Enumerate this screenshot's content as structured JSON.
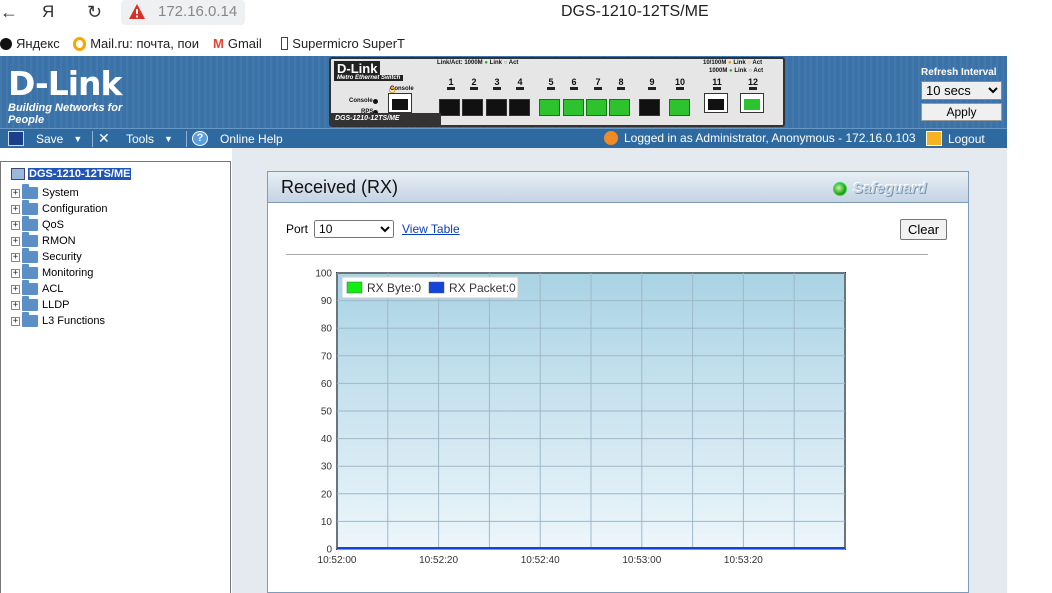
{
  "browser": {
    "back_icon": "arrow-left-icon",
    "yandex_icon": "yandex-icon",
    "reload_icon": "reload-icon",
    "security_warning_icon": "warning-triangle-icon",
    "url": "172.16.0.14",
    "page_title": "DGS-1210-12TS/ME",
    "bookmarks": [
      {
        "label": "Яндекс",
        "icon": "yandex-plus-icon",
        "color": "#111111"
      },
      {
        "label": "Mail.ru: почта, пои",
        "icon": "mailru-icon",
        "color": "#168de2"
      },
      {
        "label": "Gmail",
        "icon": "gmail-icon",
        "color": "#ea4335"
      },
      {
        "label": "Supermicro SuperT",
        "icon": "page-icon",
        "color": "#555555"
      }
    ]
  },
  "header": {
    "brand": "D-Link",
    "tagline": "Building Networks for People",
    "switch_panel": {
      "brand": "D-Link",
      "subtitle": "Metro Ethernet Switch",
      "model": "DGS-1210-12TS/ME",
      "console_label": "Console",
      "console_led_label": "Console",
      "rps_led_label": "RPS",
      "linkact_label": "Link/Act: 1000M",
      "link_label": "Link",
      "act_label": "Act",
      "legend_100": "10/100M",
      "legend_1000": "1000M",
      "ports": [
        {
          "num": "1",
          "active": false
        },
        {
          "num": "2",
          "active": false
        },
        {
          "num": "3",
          "active": false
        },
        {
          "num": "4",
          "active": false
        },
        {
          "num": "5",
          "active": true
        },
        {
          "num": "6",
          "active": true
        },
        {
          "num": "7",
          "active": true
        },
        {
          "num": "8",
          "active": true
        },
        {
          "num": "9",
          "active": false
        },
        {
          "num": "10",
          "active": true
        },
        {
          "num": "11",
          "active": false
        },
        {
          "num": "12",
          "active": true
        }
      ]
    },
    "refresh": {
      "label": "Refresh Interval",
      "selected": "10 secs",
      "apply_label": "Apply"
    }
  },
  "menubar": {
    "save": "Save",
    "tools": "Tools",
    "help": "Online Help",
    "login_status": "Logged in as Administrator, Anonymous - 172.16.0.103",
    "logout": "Logout"
  },
  "tree": {
    "root": "DGS-1210-12TS/ME",
    "items": [
      "System",
      "Configuration",
      "QoS",
      "RMON",
      "Security",
      "Monitoring",
      "ACL",
      "LLDP",
      "L3 Functions"
    ]
  },
  "panel": {
    "title": "Received (RX)",
    "safeguard": "Safeguard",
    "port_label": "Port",
    "port_selected": "10",
    "view_table": "View Table",
    "clear": "Clear"
  },
  "chart_data": {
    "type": "line",
    "legend": [
      {
        "name": "RX Byte:0",
        "color": "#11ee11"
      },
      {
        "name": "RX Packet:0",
        "color": "#1144dd"
      }
    ],
    "ylim": [
      0,
      100
    ],
    "yticks": [
      0,
      10,
      20,
      30,
      40,
      50,
      60,
      70,
      80,
      90,
      100
    ],
    "xticks": [
      "10:52:00",
      "10:52:20",
      "10:52:40",
      "10:53:00",
      "10:53:20"
    ],
    "series": [
      {
        "name": "RX Byte",
        "values": [
          0,
          0,
          0,
          0,
          0
        ]
      },
      {
        "name": "RX Packet",
        "values": [
          0,
          0,
          0,
          0,
          0
        ]
      }
    ],
    "grid": true,
    "legend_placement": "top-left"
  }
}
